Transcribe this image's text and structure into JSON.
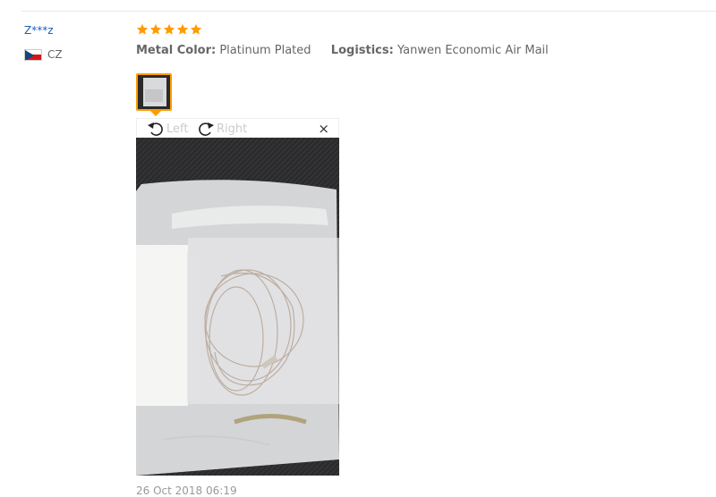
{
  "reviewer": {
    "name": "Z***z",
    "country_code": "CZ",
    "flag_icon": "czech-flag-icon"
  },
  "rating": {
    "stars": 5,
    "max": 5,
    "color": "#ff9b00"
  },
  "attributes": [
    {
      "label": "Metal Color:",
      "value": "Platinum Plated"
    },
    {
      "label": "Logistics:",
      "value": "Yanwen Economic Air Mail"
    }
  ],
  "viewer": {
    "rotate_left_label": "Left",
    "rotate_right_label": "Right",
    "close_label": "×"
  },
  "review_date": "26 Oct 2018 06:19",
  "colors": {
    "accent": "#ff9b00",
    "link": "#1a5fb4"
  }
}
